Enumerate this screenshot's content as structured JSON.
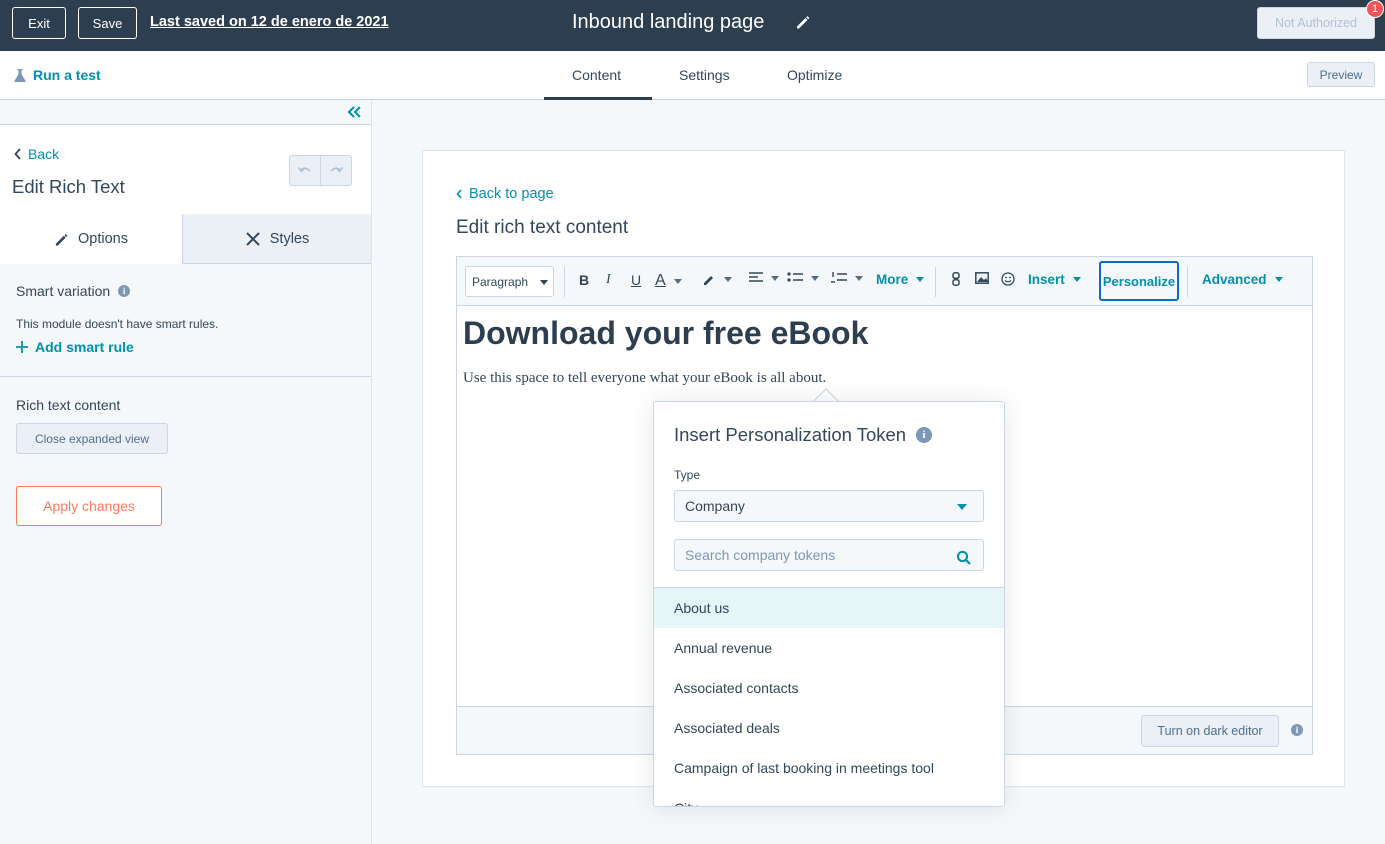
{
  "topbar": {
    "exit_label": "Exit",
    "save_label": "Save",
    "last_saved": "Last saved on 12 de enero de 2021",
    "page_title": "Inbound landing page",
    "not_authorized_label": "Not Authorized",
    "notification_count": "1"
  },
  "subbar": {
    "run_test_label": "Run a test",
    "tabs": [
      {
        "label": "Content",
        "active": true
      },
      {
        "label": "Settings",
        "active": false
      },
      {
        "label": "Optimize",
        "active": false
      }
    ],
    "preview_label": "Preview"
  },
  "left_panel": {
    "back_label": "Back",
    "title": "Edit Rich Text",
    "tabs": [
      {
        "label": "Options",
        "icon": "pencil-icon",
        "active": true
      },
      {
        "label": "Styles",
        "icon": "paintbrush-icon",
        "active": false
      }
    ],
    "smart_variation_label": "Smart variation",
    "smart_note": "This module doesn't have smart rules.",
    "add_smart_rule_label": "Add smart rule",
    "rich_text_label": "Rich text content",
    "close_expanded_label": "Close expanded view",
    "apply_changes_label": "Apply changes"
  },
  "editor": {
    "back_to_page_label": "Back to page",
    "title": "Edit rich text content",
    "toolbar": {
      "paragraph_label": "Paragraph",
      "more_label": "More",
      "insert_label": "Insert",
      "personalize_label": "Personalize",
      "advanced_label": "Advanced"
    },
    "heading": "Download your free eBook",
    "paragraph": "Use this space to tell everyone what your eBook is all about.",
    "dark_editor_label": "Turn on dark editor"
  },
  "personalization": {
    "title": "Insert Personalization Token",
    "type_label": "Type",
    "type_value": "Company",
    "search_placeholder": "Search company tokens",
    "tokens": [
      "About us",
      "Annual revenue",
      "Associated contacts",
      "Associated deals",
      "Campaign of last booking in meetings tool",
      "City"
    ]
  },
  "colors": {
    "topbar_bg": "#2d3e50",
    "accent_link": "#0091ae",
    "apply_orange": "#ff7a59",
    "badge_red": "#f2545b"
  }
}
